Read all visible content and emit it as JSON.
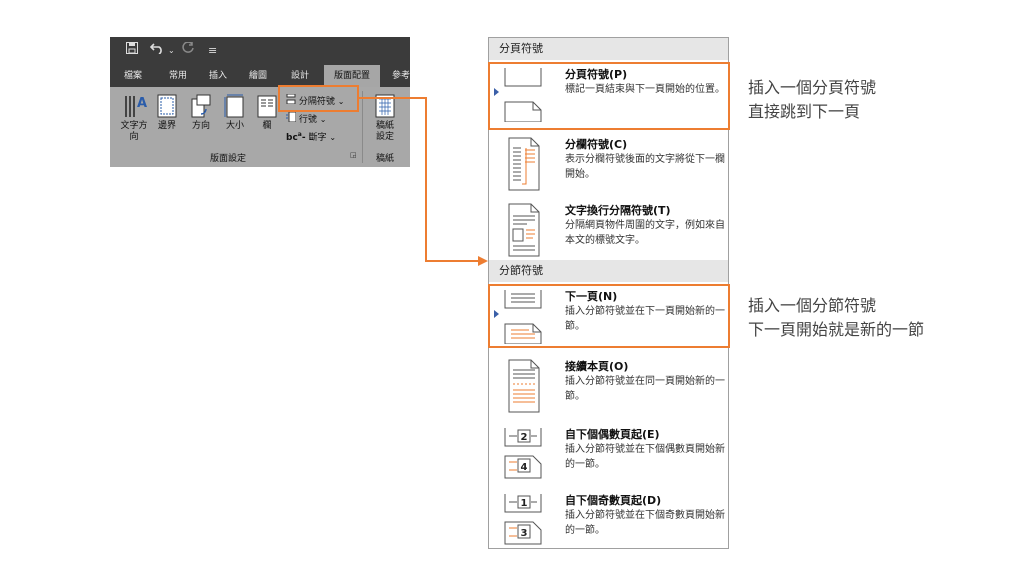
{
  "ribbon": {
    "qat": {
      "save_icon": "save-icon",
      "undo_icon": "undo-icon",
      "redo_icon": "redo-icon",
      "more": "≡"
    },
    "tabs": [
      "檔案",
      "常用",
      "插入",
      "繪圖",
      "設計",
      "版面配置",
      "參考"
    ],
    "active_tab": "版面配置",
    "buttons": {
      "text_direction": "文字方\n向",
      "margins": "邊界",
      "orientation": "方向",
      "size": "大小",
      "columns": "欄",
      "breaks": "分隔符號",
      "line_numbers": "行號",
      "hyphenation": "斷字",
      "paper": "稿紙\n設定"
    },
    "groups": {
      "page_setup": "版面設定",
      "paper": "稿紙"
    }
  },
  "menu": {
    "page_breaks_header": "分頁符號",
    "section_breaks_header": "分節符號",
    "items": [
      {
        "title": "分頁符號(P)",
        "desc": "標記一頁結束與下一頁開始的位置。"
      },
      {
        "title": "分欄符號(C)",
        "desc": "表示分欄符號後面的文字將從下一欄開始。"
      },
      {
        "title": "文字換行分隔符號(T)",
        "desc": "分隔網頁物件周圍的文字，例如來自本文的標號文字。"
      },
      {
        "title": "下一頁(N)",
        "desc": "插入分節符號並在下一頁開始新的一節。"
      },
      {
        "title": "接續本頁(O)",
        "desc": "插入分節符號並在同一頁開始新的一節。"
      },
      {
        "title": "自下個偶數頁起(E)",
        "desc": "插入分節符號並在下個偶數頁開始新的一節。"
      },
      {
        "title": "自下個奇數頁起(D)",
        "desc": "插入分節符號並在下個奇數頁開始新的一節。"
      }
    ],
    "icon_numbers": {
      "even_top": "2",
      "even_bottom": "4",
      "odd_top": "1",
      "odd_bottom": "3"
    }
  },
  "notes": {
    "page_break": [
      "插入一個分頁符號",
      "直接跳到下一頁"
    ],
    "section_break": [
      "插入一個分節符號",
      "下一頁開始就是新的一節"
    ]
  },
  "colors": {
    "accent": "#ED7D31",
    "ribbon_bg": "#a8a8a8",
    "ribbon_dark": "#3b3b3b",
    "active_tab": "#a6a6a6"
  }
}
